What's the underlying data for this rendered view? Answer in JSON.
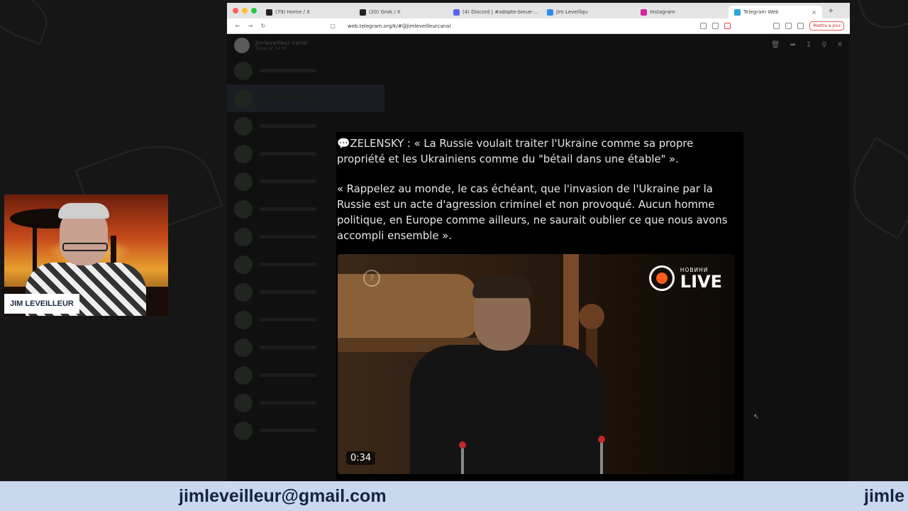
{
  "browser": {
    "tabs": [
      {
        "label": "(79) Home / X",
        "favicon_color": "#222222",
        "active": false
      },
      {
        "label": "(20) Grok / X",
        "favicon_color": "#222222",
        "active": false
      },
      {
        "label": "(4) Discord | #adopte-bieue-...",
        "favicon_color": "#5865f2",
        "active": false
      },
      {
        "label": "Jim Leveillqu",
        "favicon_color": "#2d8cf0",
        "active": false
      },
      {
        "label": "Instagram",
        "favicon_color": "#d6249f",
        "active": false
      },
      {
        "label": "Telegram Web",
        "favicon_color": "#2aa3e0",
        "active": true
      }
    ],
    "new_tab_symbol": "+",
    "close_tab_symbol": "×",
    "url": "web.telegram.org/k/#@jimleveilleurcanal",
    "update_button_label": "Mettre à jour"
  },
  "telegram": {
    "chat_name": "Jimleveilleur canal",
    "chat_subtitle": "Today at 14:56",
    "viewer_tools": [
      "delete-icon",
      "forward-icon",
      "download-icon",
      "zoom-icon",
      "close-icon"
    ],
    "message": {
      "speech_icon": "💬",
      "paragraph1": "ZELENSKY : « La Russie voulait traiter l'Ukraine comme sa propre propriété et les Ukrainiens comme du \"bétail dans une étable\" ».",
      "paragraph2": "« Rappelez au monde, le cas échéant, que l'invasion de l'Ukraine par la Russie est un acte d'agression criminel et non provoqué. Aucun homme politique, en Europe comme ailleurs, ne saurait oublier ce que nous avons accompli ensemble »."
    },
    "video": {
      "badge_small": "НОВИНИ",
      "badge_big": "LIVE",
      "badge_color": "#ff5a1f",
      "duration": "0:34"
    }
  },
  "webcam": {
    "name": "JIM LEVEILLEUR"
  },
  "banner": {
    "email": "jimleveilleur@gmail.com",
    "email_repeat": "jimle"
  }
}
